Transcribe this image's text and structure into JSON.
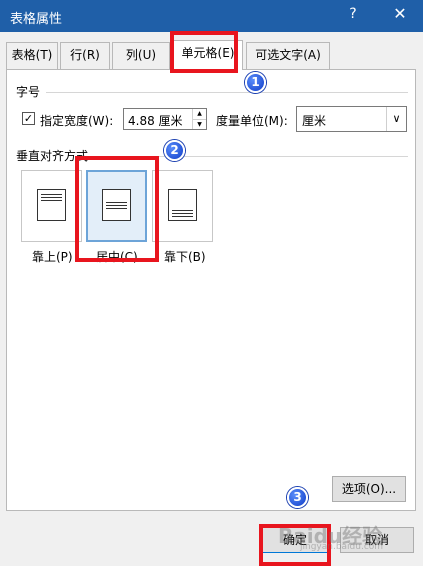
{
  "window": {
    "title": "表格属性",
    "help_glyph": "?",
    "close_glyph": "✕"
  },
  "tabs": [
    {
      "label": "表格(T)",
      "active": false
    },
    {
      "label": "行(R)",
      "active": false
    },
    {
      "label": "列(U)",
      "active": false
    },
    {
      "label": "单元格(E)",
      "active": true
    },
    {
      "label": "可选文字(A)",
      "active": false
    }
  ],
  "size_section": {
    "label": "字号",
    "checkbox_checked": true,
    "checkbox_glyph": "✓",
    "width_label": "指定宽度(W):",
    "width_value": "4.88 厘米",
    "unit_label": "度量单位(M):",
    "unit_value": "厘米",
    "unit_arrow": "∨"
  },
  "valign_section": {
    "label": "垂直对齐方式",
    "options": [
      {
        "label": "靠上(P)",
        "selected": false
      },
      {
        "label": "居中(C)",
        "selected": true
      },
      {
        "label": "靠下(B)",
        "selected": false
      }
    ]
  },
  "buttons": {
    "options": "选项(O)...",
    "ok": "确定",
    "cancel": "取消"
  },
  "annotations": {
    "badge1": "1",
    "badge2": "2",
    "badge3": "3",
    "highlight_color": "#e8151e"
  },
  "watermark": {
    "text": "Baidu经验",
    "sub": "jingyan.baidu.com"
  },
  "colors": {
    "titlebar": "#1f5fa8",
    "dialog_bg": "#f0f0f0",
    "selected_option": "#e3eef9"
  }
}
